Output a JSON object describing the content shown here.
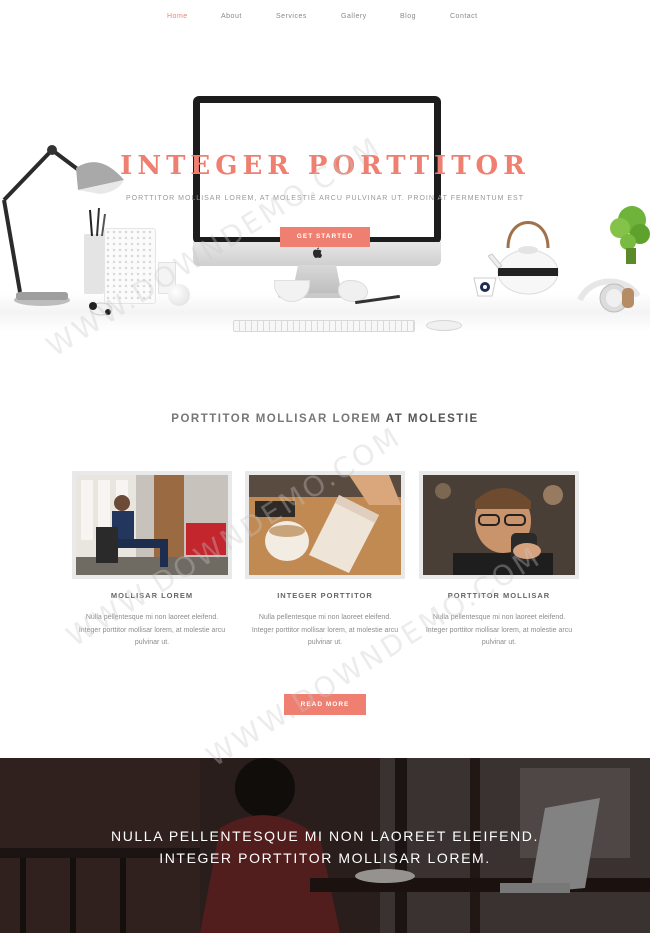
{
  "nav": {
    "items": [
      {
        "label": "Home",
        "active": true
      },
      {
        "label": "About"
      },
      {
        "label": "Services"
      },
      {
        "label": "Gallery"
      },
      {
        "label": "Blog"
      },
      {
        "label": "Contact"
      }
    ]
  },
  "hero": {
    "title": "INTEGER PORTTITOR",
    "subtitle": "PORTTITOR MOLLISAR LOREM, AT MOLESTIE ARCU PULVINAR UT. PROIN AT FERMENTUM EST",
    "button_label": "GET STARTED"
  },
  "features": {
    "title_regular": "PORTTITOR MOLLISAR LOREM ",
    "title_bold": "AT MOLESTIE",
    "cards": [
      {
        "name": "MOLLISAR LOREM",
        "description": "Nulla pellentesque mi non laoreet eleifend. Integer porttitor mollisar lorem, at molestie arcu pulvinar ut."
      },
      {
        "name": "INTEGER PORTTITOR",
        "description": "Nulla pellentesque mi non laoreet eleifend. Integer porttitor mollisar lorem, at molestie arcu pulvinar ut."
      },
      {
        "name": "PORTTITOR MOLLISAR",
        "description": "Nulla pellentesque mi non laoreet eleifend. Integer porttitor mollisar lorem, at molestie arcu pulvinar ut."
      }
    ],
    "read_more_label": "READ MORE"
  },
  "banner": {
    "line1": "NULLA PELLENTESQUE MI NON LAOREET ELEIFEND.",
    "line2": "INTEGER PORTTITOR MOLLISAR LOREM."
  },
  "watermark": "WWW.DOWNDEMO.COM",
  "colors": {
    "accent": "#ef7f70",
    "text": "#666666",
    "muted": "#8d8d8d"
  }
}
